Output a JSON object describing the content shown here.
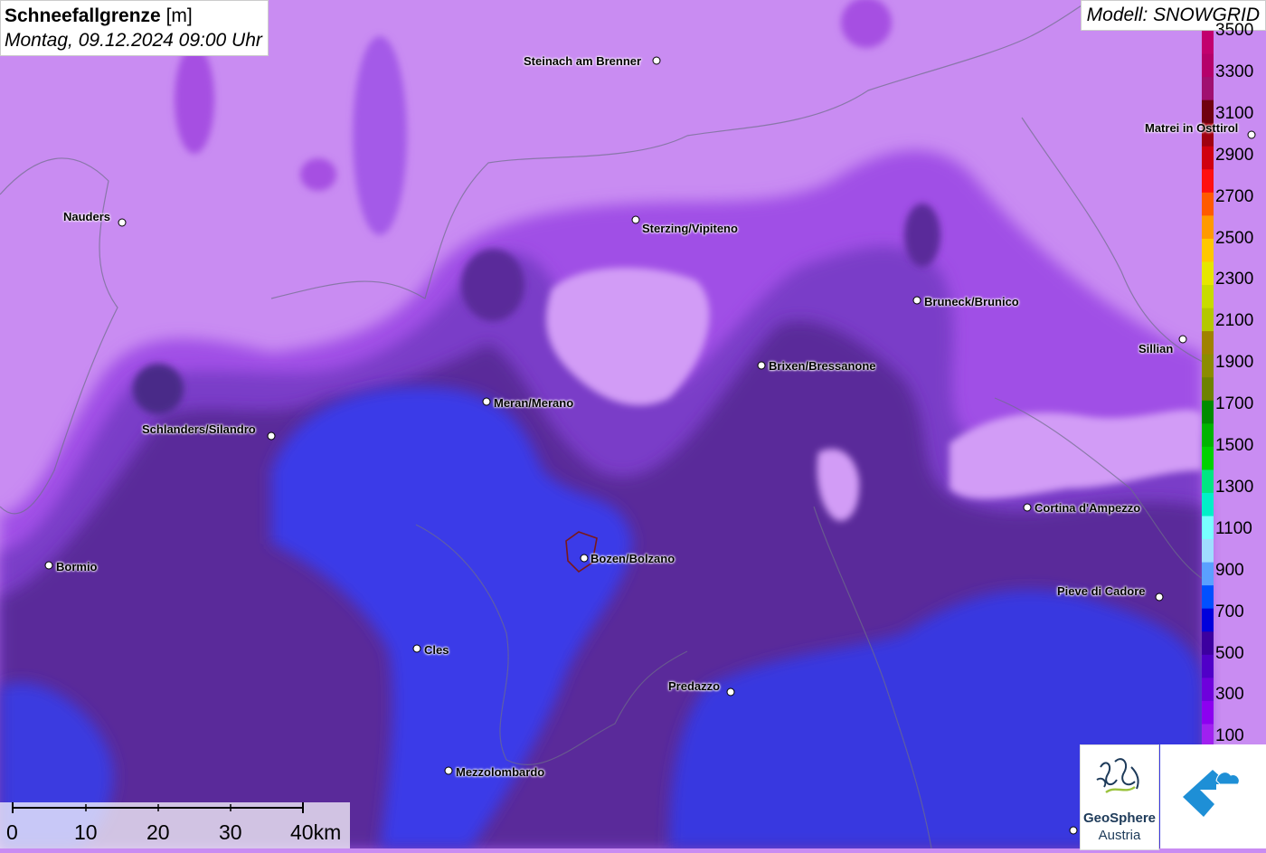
{
  "title": {
    "main": "Schneefallgrenze",
    "unit": "[m]",
    "datetime": "Montag, 09.12.2024 09:00 Uhr"
  },
  "model": "Modell: SNOWGRID",
  "legend": {
    "labels": [
      "3500",
      "3300",
      "3100",
      "2900",
      "2700",
      "2500",
      "2300",
      "2100",
      "1900",
      "1700",
      "1500",
      "1300",
      "1100",
      "900",
      "700",
      "500",
      "300",
      "100"
    ],
    "colors": [
      "#c2006e",
      "#b5006a",
      "#a01070",
      "#700010",
      "#a00010",
      "#d00010",
      "#ff1010",
      "#ff5a00",
      "#ff9a00",
      "#ffc800",
      "#e6e600",
      "#c8dc00",
      "#b4c800",
      "#a08200",
      "#8c8c00",
      "#6e8200",
      "#008c00",
      "#00b400",
      "#00d200",
      "#00e682",
      "#00f0c8",
      "#78ffff",
      "#a0dcff",
      "#5aa0ff",
      "#0050ff",
      "#0000dc",
      "#3c00a0",
      "#5000c8",
      "#6e00dc",
      "#8c00f0",
      "#a020f0"
    ]
  },
  "cities": [
    {
      "name": "Steinach am Brenner"
    },
    {
      "name": "Nauders"
    },
    {
      "name": "Sterzing/Vipiteno"
    },
    {
      "name": "Matrei in Osttirol"
    },
    {
      "name": "Bruneck/Brunico"
    },
    {
      "name": "Sillian"
    },
    {
      "name": "Brixen/Bressanone"
    },
    {
      "name": "Meran/Merano"
    },
    {
      "name": "Schlanders/Silandro"
    },
    {
      "name": "Cortina d'Ampezzo"
    },
    {
      "name": "Bormio"
    },
    {
      "name": "Bozen/Bolzano"
    },
    {
      "name": "Pieve di Cadore"
    },
    {
      "name": "Cles"
    },
    {
      "name": "Predazzo"
    },
    {
      "name": "Mezzolombardo"
    }
  ],
  "scalebar": {
    "labels": [
      "0",
      "10",
      "20",
      "30",
      "40km"
    ]
  },
  "logos": {
    "geosphere_line1": "GeoSphere",
    "geosphere_line2": "Austria"
  }
}
